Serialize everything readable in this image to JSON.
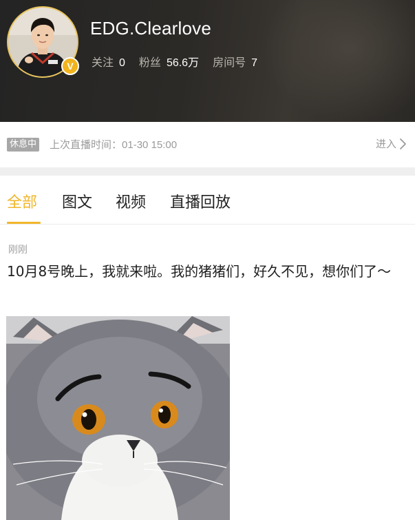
{
  "profile": {
    "username": "EDG.Clearlove",
    "verified_badge": "V",
    "stats": [
      {
        "label": "关注",
        "value": "0"
      },
      {
        "label": "粉丝",
        "value": "56.6万"
      },
      {
        "label": "房间号",
        "value": "7"
      }
    ]
  },
  "status": {
    "badge": "休息中",
    "last_live_label": "上次直播时间：",
    "last_live_time": "01-30 15:00",
    "enter_label": "进入"
  },
  "tabs": [
    {
      "label": "全部",
      "active": true
    },
    {
      "label": "图文",
      "active": false
    },
    {
      "label": "视频",
      "active": false
    },
    {
      "label": "直播回放",
      "active": false
    }
  ],
  "post": {
    "time": "刚刚",
    "text": "10月8号晚上，我就来啦。我的猪猪们，好久不见，想你们了～"
  },
  "colors": {
    "accent": "#f0b62a",
    "header_bg": "#2a2825",
    "muted_text": "#9a9a9a"
  },
  "icons": {
    "enter": "chevron-right-icon",
    "verified": "verified-badge-icon"
  }
}
